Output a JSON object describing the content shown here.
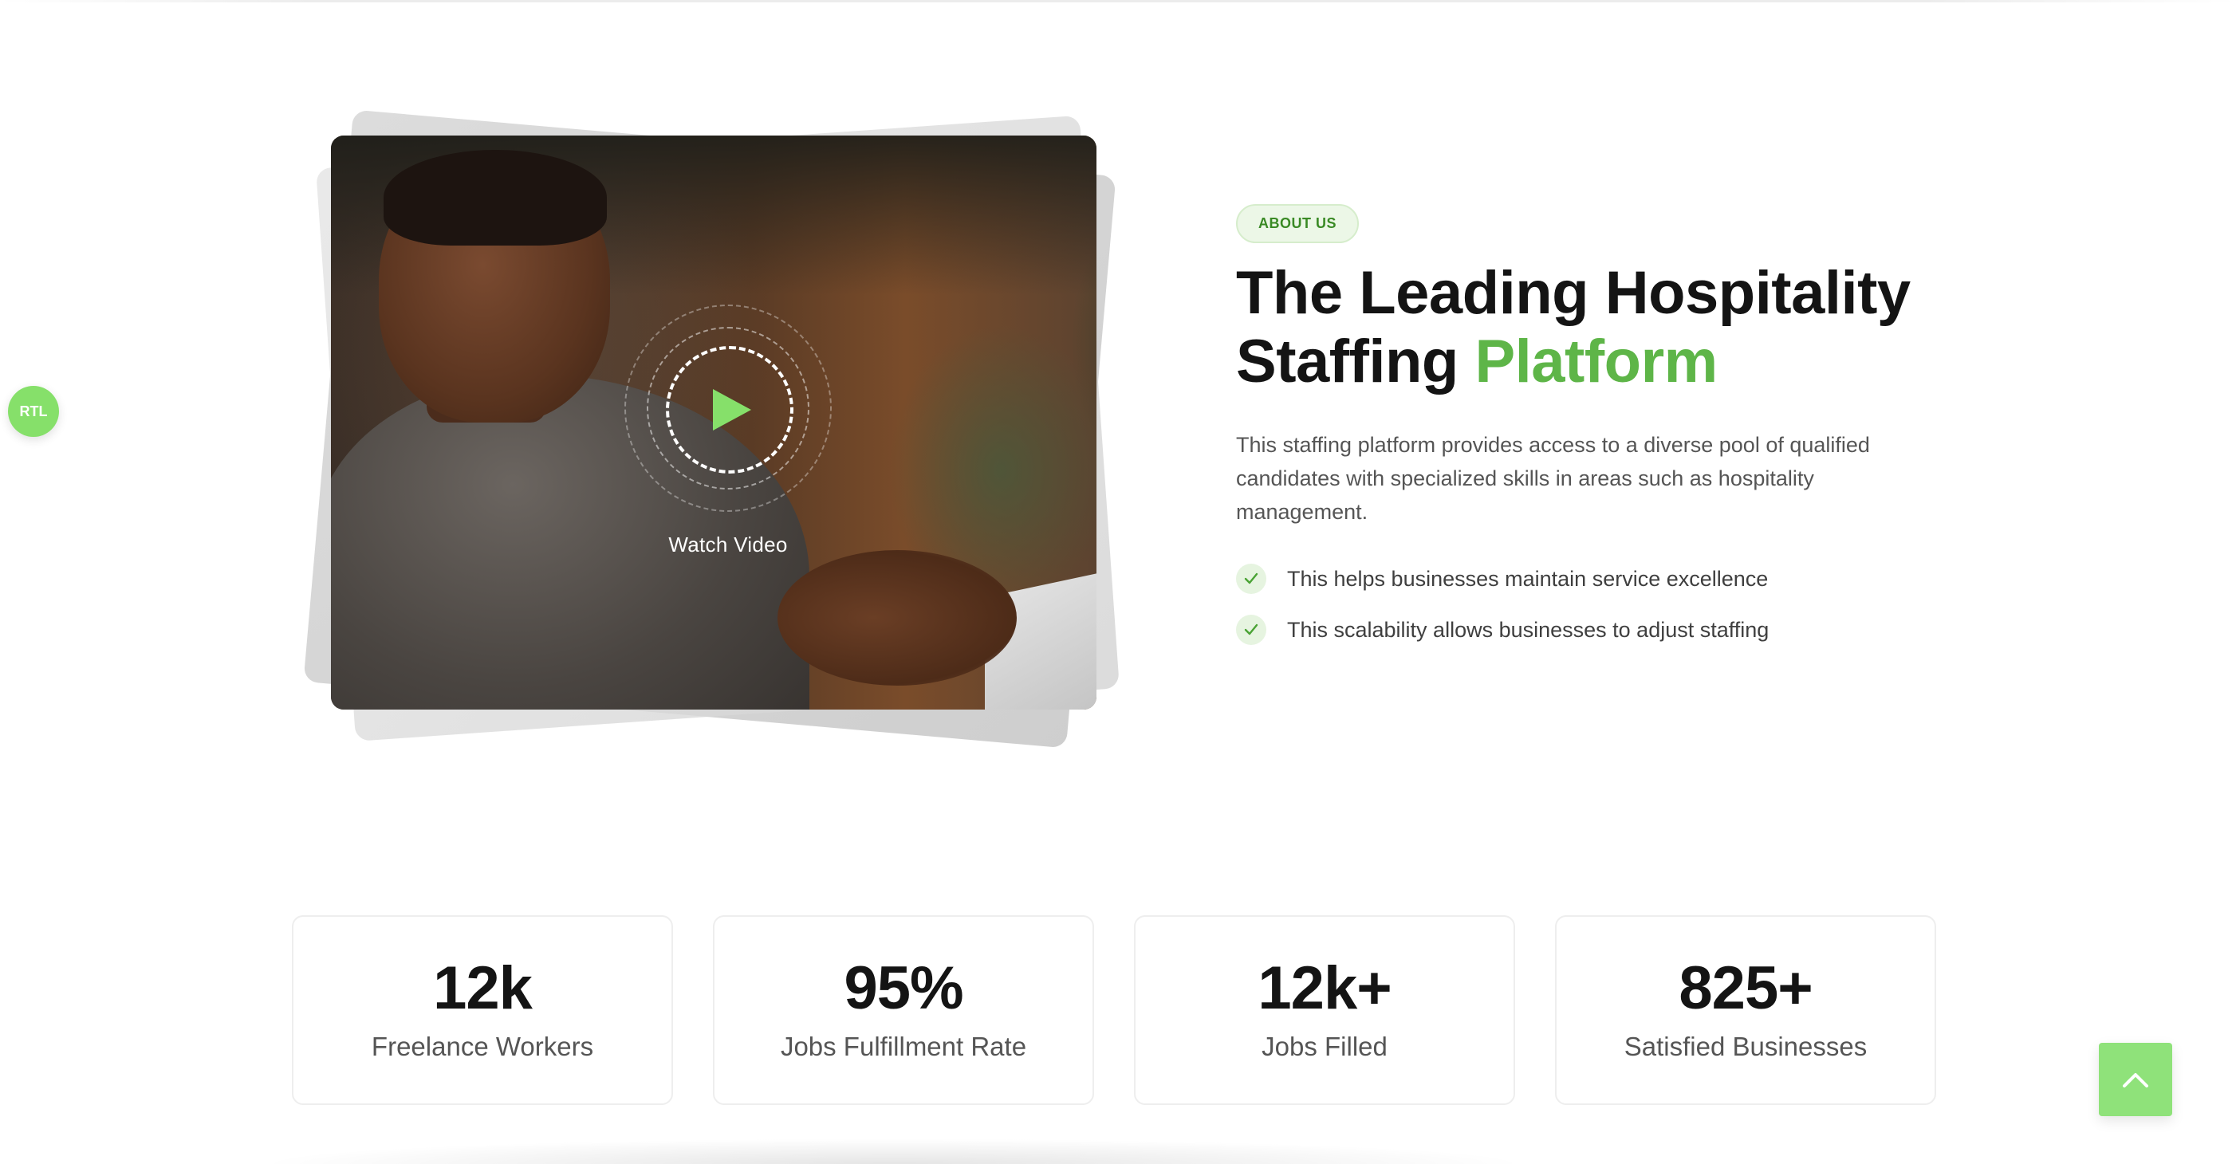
{
  "floating": {
    "rtl_label": "RTL"
  },
  "media": {
    "watch_label": "Watch Video",
    "play_icon": "play-icon"
  },
  "about": {
    "badge": "ABOUT US",
    "headline_line1": "The Leading Hospitality",
    "headline_line2_plain": "Staffing ",
    "headline_line2_accent": "Platform",
    "lead": "This staffing platform provides access to a diverse pool of qualified candidates with specialized skills in areas such as hospitality management.",
    "checks": [
      "This helps businesses maintain service excellence",
      "This scalability allows businesses to adjust staffing"
    ]
  },
  "stats": [
    {
      "value": "12k",
      "label": "Freelance Workers"
    },
    {
      "value": "95%",
      "label": "Jobs Fulfillment Rate"
    },
    {
      "value": "12k+",
      "label": "Jobs Filled"
    },
    {
      "value": "825+",
      "label": "Satisfied Businesses"
    }
  ],
  "colors": {
    "accent_green": "#5eb548",
    "button_green": "#8fe27a",
    "badge_bg": "#ecf7e7",
    "text_dark": "#141414",
    "text_muted": "#555555"
  }
}
